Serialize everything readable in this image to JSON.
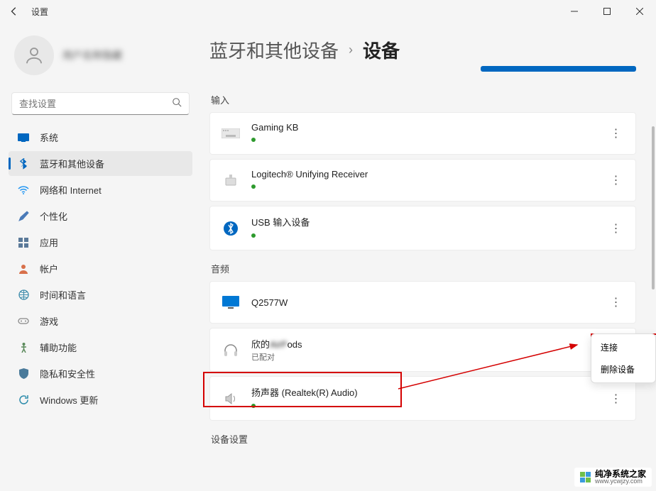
{
  "window": {
    "title": "设置"
  },
  "profile": {
    "name": "用户名称隐藏"
  },
  "search": {
    "placeholder": "查找设置"
  },
  "nav": [
    {
      "id": "system",
      "label": "系统"
    },
    {
      "id": "bluetooth",
      "label": "蓝牙和其他设备",
      "selected": true
    },
    {
      "id": "network",
      "label": "网络和 Internet"
    },
    {
      "id": "personalize",
      "label": "个性化"
    },
    {
      "id": "apps",
      "label": "应用"
    },
    {
      "id": "accounts",
      "label": "帐户"
    },
    {
      "id": "time",
      "label": "时间和语言"
    },
    {
      "id": "gaming",
      "label": "游戏"
    },
    {
      "id": "accessibility",
      "label": "辅助功能"
    },
    {
      "id": "privacy",
      "label": "隐私和安全性"
    },
    {
      "id": "update",
      "label": "Windows 更新"
    }
  ],
  "breadcrumb": {
    "parent": "蓝牙和其他设备",
    "current": "设备"
  },
  "sections": {
    "input": {
      "label": "输入",
      "devices": [
        {
          "name": "Gaming KB",
          "icon": "keyboard",
          "status": "connected"
        },
        {
          "name": "Logitech® Unifying Receiver",
          "icon": "receiver",
          "status": "connected"
        },
        {
          "name": "USB 输入设备",
          "icon": "bluetooth",
          "status": "connected"
        }
      ]
    },
    "audio": {
      "label": "音频",
      "devices": [
        {
          "name": "Q2577W",
          "icon": "monitor",
          "status": "none"
        },
        {
          "name_prefix": "欣的",
          "name_blur": "AirP",
          "name_suffix": "ods",
          "sub": "已配对",
          "icon": "headphones",
          "highlighted": true
        },
        {
          "name": "扬声器 (Realtek(R) Audio)",
          "icon": "speaker",
          "status": "connected"
        }
      ]
    },
    "device_settings": {
      "label": "设备设置"
    }
  },
  "context_menu": {
    "connect": "连接",
    "remove": "删除设备"
  },
  "watermark": {
    "line1": "纯净系统之家",
    "line2": "www.ycwjzy.com"
  }
}
